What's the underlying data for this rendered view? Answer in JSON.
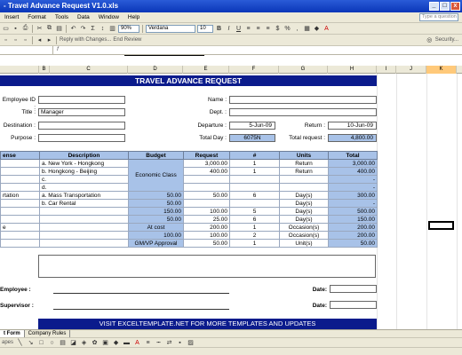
{
  "window": {
    "title": "- Travel Advance Request V1.0.xls",
    "controls": [
      "_",
      "□",
      "x"
    ]
  },
  "menu": {
    "items": [
      "Insert",
      "Format",
      "Tools",
      "Data",
      "Window",
      "Help"
    ],
    "help_placeholder": "Type a question"
  },
  "toolbar": {
    "zoom": "90%",
    "font": "Verdana",
    "font_size": "10",
    "reply_changes": "Reply with Changes...",
    "end_review": "End Review",
    "security": "Security..."
  },
  "columns": [
    "B",
    "C",
    "D",
    "E",
    "F",
    "G",
    "H",
    "I",
    "J",
    "K"
  ],
  "selected_column": "K",
  "form": {
    "banner": "TRAVEL ADVANCE REQUEST",
    "employee_id_label": "Employee ID :",
    "title_label": "Title :",
    "title_value": "Manager",
    "destination_label": "Destination :",
    "purpose_label": "Purpose :",
    "name_label": "Name :",
    "dept_label": "Dept. :",
    "departure_label": "Departure :",
    "departure_value": "5-Jun-09",
    "return_label": "Return :",
    "return_value": "10-Jun-09",
    "total_day_label": "Total Day :",
    "total_day_value": "6075N",
    "total_request_label": "Total request :",
    "total_request_value": "4,800.00"
  },
  "table": {
    "headers": [
      "ense",
      "Description",
      "Budget",
      "Request",
      "#",
      "Units",
      "Total"
    ],
    "rows": [
      {
        "exp": "",
        "desc": "a.  New York - Hongkong",
        "budget": "",
        "request": "3,000.00",
        "num": "1",
        "units": "Return",
        "total": "3,000.00"
      },
      {
        "exp": "",
        "desc": "b.  Hongkong - Beijing",
        "budget": "",
        "request": "400.00",
        "num": "1",
        "units": "Return",
        "total": "400.00"
      },
      {
        "exp": "",
        "desc": "c.",
        "budget": "",
        "request": "",
        "num": "",
        "units": "",
        "total": "-"
      },
      {
        "exp": "",
        "desc": "d.",
        "budget": "",
        "request": "",
        "num": "",
        "units": "",
        "total": "-"
      },
      {
        "exp": "rtation",
        "desc": "a.  Mass Transportation",
        "budget": "50.00",
        "request": "50.00",
        "num": "6",
        "units": "Day(s)",
        "total": "300.00"
      },
      {
        "exp": "",
        "desc": "b.  Car Rental",
        "budget": "50.00",
        "request": "",
        "num": "",
        "units": "Day(s)",
        "total": "-"
      },
      {
        "exp": "",
        "desc": "",
        "budget": "150.00",
        "request": "100.00",
        "num": "5",
        "units": "Day(s)",
        "total": "500.00"
      },
      {
        "exp": "",
        "desc": "",
        "budget": "50.00",
        "request": "25.00",
        "num": "6",
        "units": "Day(s)",
        "total": "150.00"
      },
      {
        "exp": "e",
        "desc": "",
        "budget": "At cost",
        "request": "200.00",
        "num": "1",
        "units": "Occasion(s)",
        "total": "200.00"
      },
      {
        "exp": "",
        "desc": "",
        "budget": "100.00",
        "request": "100.00",
        "num": "2",
        "units": "Occasion(s)",
        "total": "200.00"
      },
      {
        "exp": "",
        "desc": "",
        "budget": "GM/VP Approval",
        "request": "50.00",
        "num": "1",
        "units": "Unit(s)",
        "total": "50.00"
      }
    ],
    "economic_class": "Economic Class"
  },
  "signatures": {
    "employee_label": "Employee :",
    "supervisor_label": "Supervisor :",
    "date_label": "Date:"
  },
  "footer": {
    "banner": "VISIT EXCELTEMPLATE.NET FOR MORE TEMPLATES AND UPDATES"
  },
  "sheet_tabs": [
    "t Form",
    "Company Rules"
  ],
  "draw_toolbar": {
    "shapes_label": "apes"
  }
}
